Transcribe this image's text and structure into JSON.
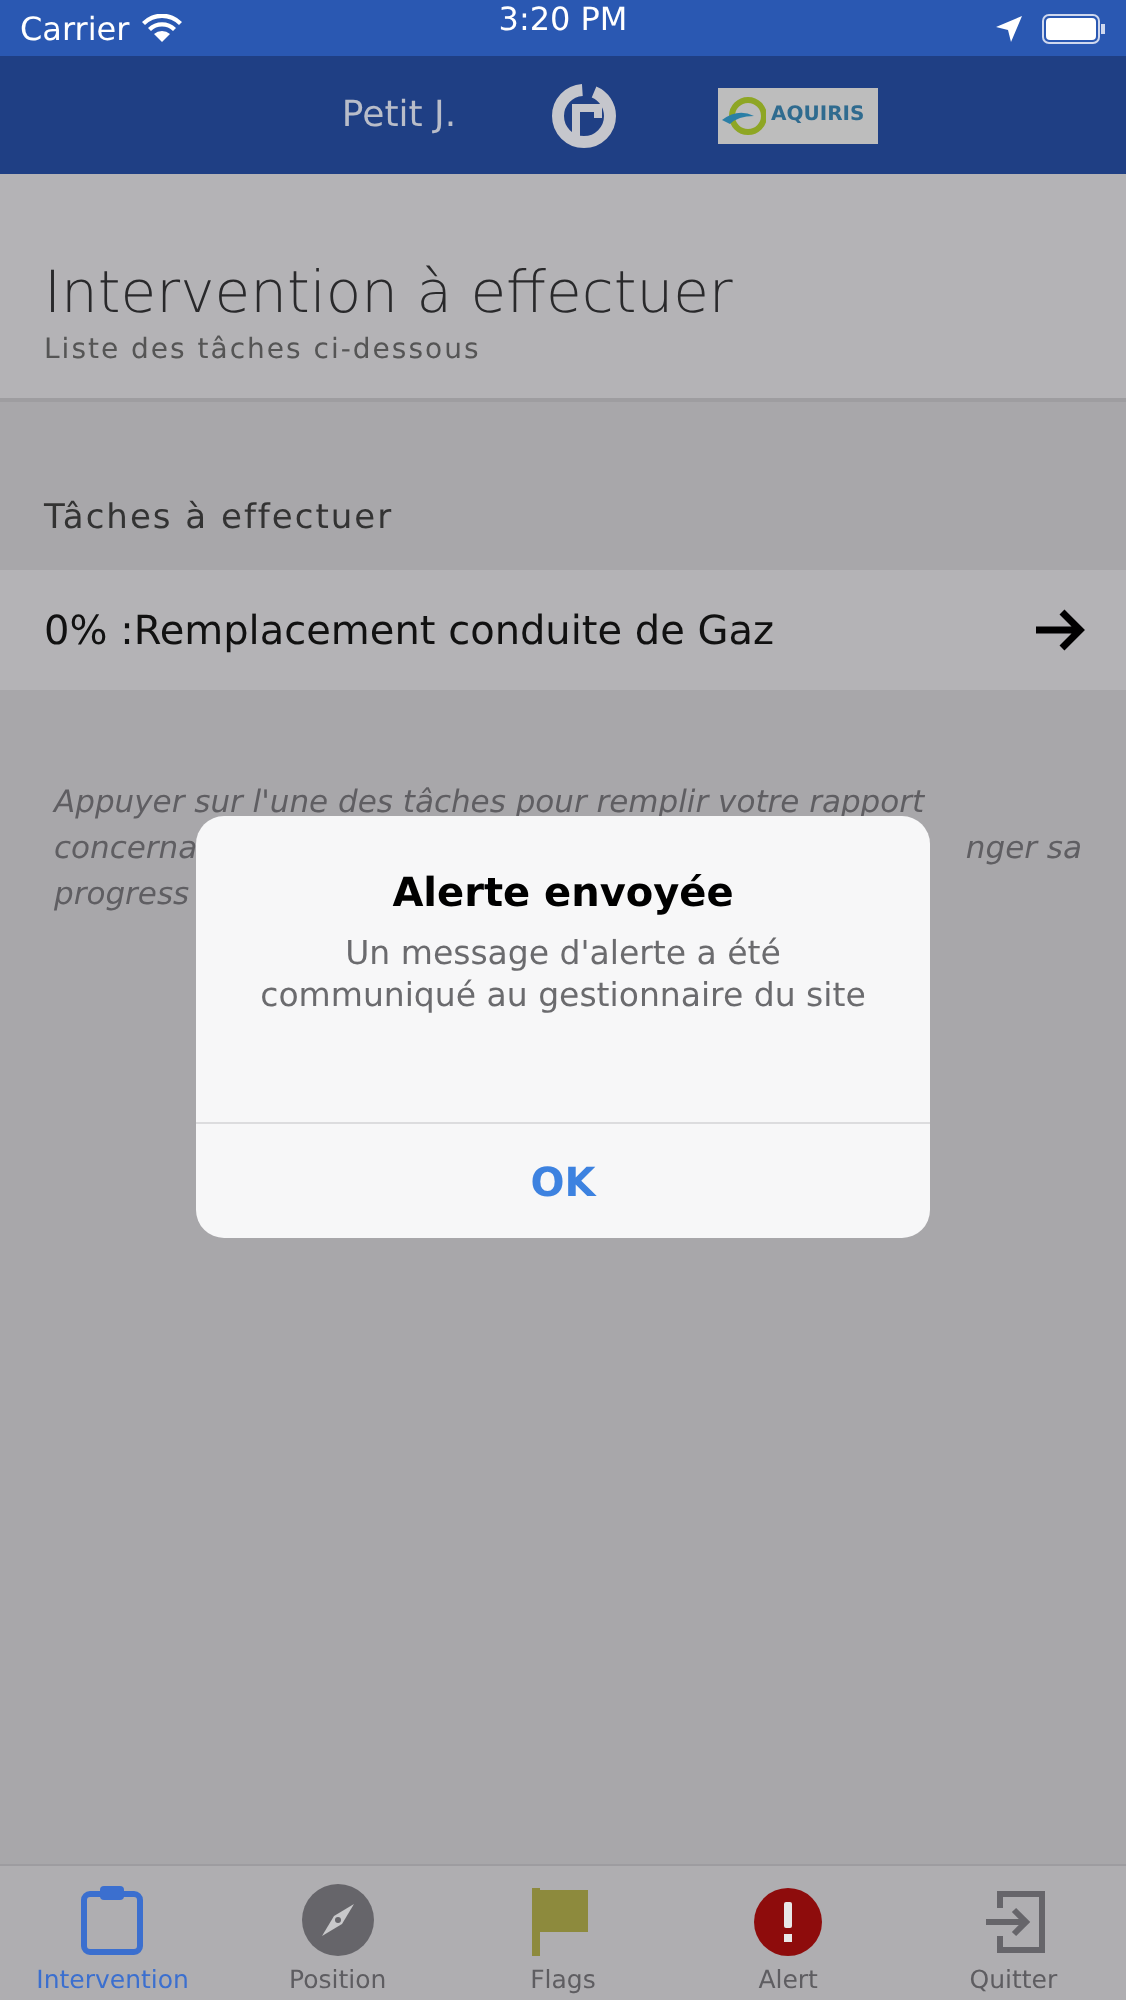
{
  "status_bar": {
    "carrier": "Carrier",
    "time": "3:20 PM"
  },
  "nav_bar": {
    "user": "Petit J.",
    "partner_logo": "AQUIRIS"
  },
  "header": {
    "title": "Intervention à effectuer",
    "subtitle": "Liste des tâches ci-dessous"
  },
  "section": {
    "title": "Tâches à effectuer"
  },
  "tasks": [
    {
      "label": "0% :Remplacement conduite de Gaz"
    }
  ],
  "hint": {
    "line_1": "Appuyer sur l'une des tâches pour remplir votre rapport",
    "line_2_start": "concerna",
    "line_2_end": "nger sa",
    "line_3": "progress"
  },
  "alert": {
    "title": "Alerte envoyée",
    "message": "Un message d'alerte a été communiqué au gestionnaire du site",
    "button": "OK"
  },
  "tabs": [
    {
      "kind": "clipboard",
      "label": "Intervention",
      "selected": true
    },
    {
      "kind": "compass",
      "label": "Position",
      "selected": false
    },
    {
      "kind": "flag",
      "label": "Flags",
      "selected": false
    },
    {
      "kind": "alert",
      "label": "Alert",
      "selected": false
    },
    {
      "kind": "exit",
      "label": "Quitter",
      "selected": false
    }
  ]
}
